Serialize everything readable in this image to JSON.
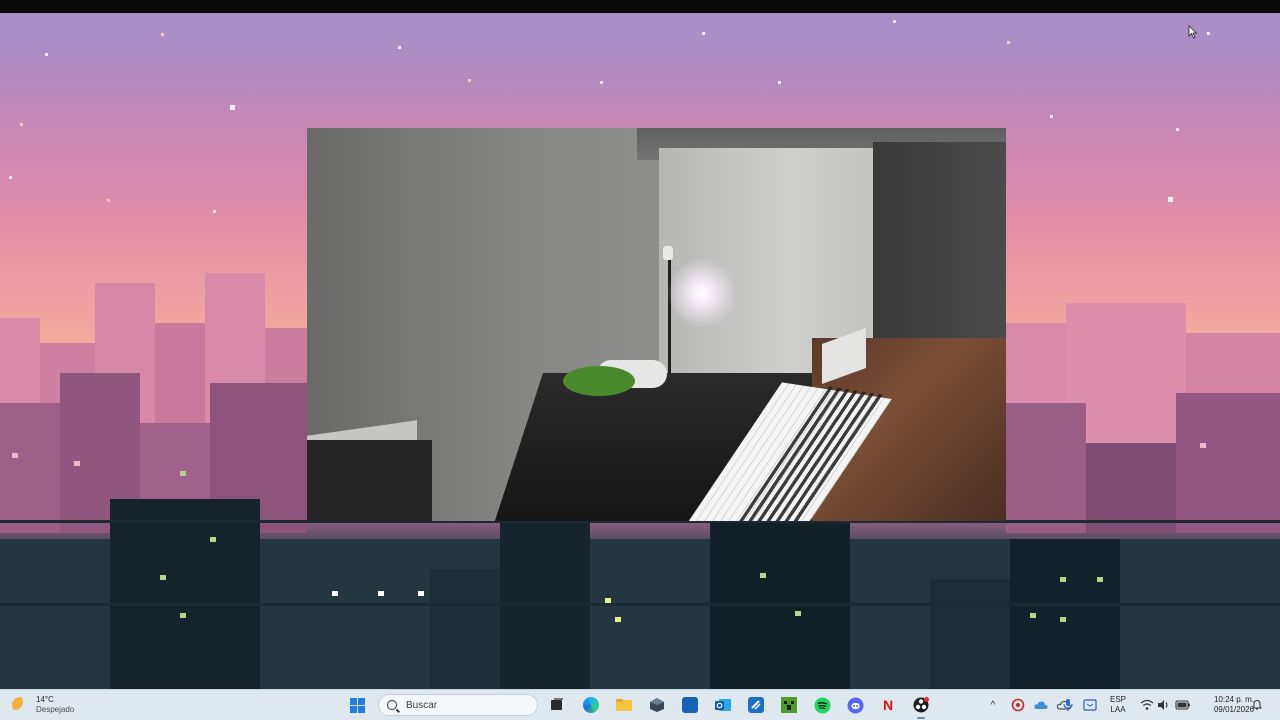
{
  "desktop": {
    "wallpaper": "pixel-art city skyline at dusk",
    "accent_colors": {
      "sky_top": "#a690c9",
      "sky_mid": "#e28fa8",
      "sky_low": "#f3ad9c",
      "city_dark": "#1a262d",
      "taskbar_bg": "#dfe8ee"
    }
  },
  "webcam_window": {
    "content": "webcam view of room with piano"
  },
  "taskbar": {
    "weather": {
      "temperature": "14°C",
      "condition": "Despejado",
      "icon": "moon-icon"
    },
    "start_icon": "windows-start-icon",
    "search": {
      "placeholder": "Buscar"
    },
    "pinned_apps": [
      {
        "name": "task-view-icon"
      },
      {
        "name": "edge-icon"
      },
      {
        "name": "file-explorer-icon"
      },
      {
        "name": "app-cube-icon"
      },
      {
        "name": "microsoft-store-icon"
      },
      {
        "name": "outlook-icon"
      },
      {
        "name": "visual-studio-icon"
      },
      {
        "name": "minecraft-icon"
      },
      {
        "name": "spotify-icon"
      },
      {
        "name": "discord-icon"
      },
      {
        "name": "netflix-icon"
      },
      {
        "name": "obs-icon"
      }
    ],
    "netflix_letter": "N",
    "tray": {
      "chevron": "^",
      "language_line1": "ESP",
      "language_line2": "LAA",
      "time": "10:24 p. m.",
      "date": "09/01/2026"
    }
  }
}
